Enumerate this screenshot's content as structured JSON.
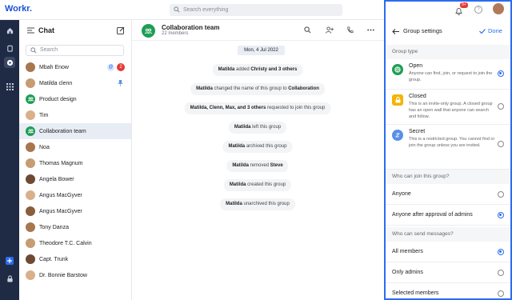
{
  "app": {
    "logo": "Workr",
    "logo_dot": "."
  },
  "search": {
    "placeholder": "Search everything"
  },
  "notifications": {
    "badge": "9+"
  },
  "sidebar": {
    "title": "Chat",
    "search_placeholder": "Search",
    "chats": [
      {
        "name": "Mbah Enow",
        "type": "person",
        "unread": "2"
      },
      {
        "name": "Matilda clenn",
        "type": "person",
        "pinned": true
      },
      {
        "name": "Product design",
        "type": "group"
      },
      {
        "name": "Tim",
        "type": "person"
      },
      {
        "name": "Collaboration team",
        "type": "group",
        "selected": true
      },
      {
        "name": "Noa",
        "type": "person"
      },
      {
        "name": "Thomas Magnum",
        "type": "person"
      },
      {
        "name": "Angela Bower",
        "type": "person"
      },
      {
        "name": "Angus MacGyver",
        "type": "person"
      },
      {
        "name": "Angus MacGyver",
        "type": "person"
      },
      {
        "name": "Tony Danza",
        "type": "person"
      },
      {
        "name": "Theodore T.C. Calvin",
        "type": "person"
      },
      {
        "name": "Capt. Trunk",
        "type": "person"
      },
      {
        "name": "Dr. Bonnie Barstow",
        "type": "person"
      }
    ]
  },
  "conversation": {
    "name": "Collaboration team",
    "members": "22 members",
    "date": "Mon, 4 Jul 2022",
    "events": [
      {
        "actor": "Matilda",
        "text": " added ",
        "target": "Christy and 3 others"
      },
      {
        "actor": "Matilda",
        "text": " changed the name of this group to ",
        "target": "Collaboration"
      },
      {
        "actor": "Matilda, Clenn, Max, and 3 others",
        "text": " requested to join this group",
        "target": ""
      },
      {
        "actor": "Matilda",
        "text": " left this group",
        "target": ""
      },
      {
        "actor": "Matilda",
        "text": " archived this group",
        "target": ""
      },
      {
        "actor": "Matilda",
        "text": " removed ",
        "target": "Steve"
      },
      {
        "actor": "Matilda",
        "text": " created this group",
        "target": ""
      },
      {
        "actor": "Matilda",
        "text": " unarchived this group",
        "target": ""
      }
    ]
  },
  "settings": {
    "title": "Group settings",
    "done": "Done",
    "group_type_label": "Group type",
    "types": [
      {
        "title": "Open",
        "desc": "Anyone can find, join, or request to join the group.",
        "selected": true,
        "color": "#1f9d55"
      },
      {
        "title": "Closed",
        "desc": "This is an invite-only group. A closed group has an open wall that anyone can search and follow.",
        "selected": false,
        "color": "#f4b400"
      },
      {
        "title": "Secret",
        "desc": "This is a restricted group. You cannot find or join the group unless you are invited.",
        "selected": false,
        "color": "#5a8fe8"
      }
    ],
    "join_label": "Who can join this group?",
    "join_options": [
      {
        "label": "Anyone",
        "selected": false
      },
      {
        "label": "Anyone after approval of admins",
        "selected": true
      }
    ],
    "send_label": "Who can send messages?",
    "send_options": [
      {
        "label": "All members",
        "selected": true
      },
      {
        "label": "Only admins",
        "selected": false
      },
      {
        "label": "Selected members",
        "selected": false
      }
    ]
  },
  "colors": {
    "accent": "#2b6cf0",
    "rail": "#1f2a44",
    "group": "#1f9d55",
    "badge": "#e53935"
  }
}
